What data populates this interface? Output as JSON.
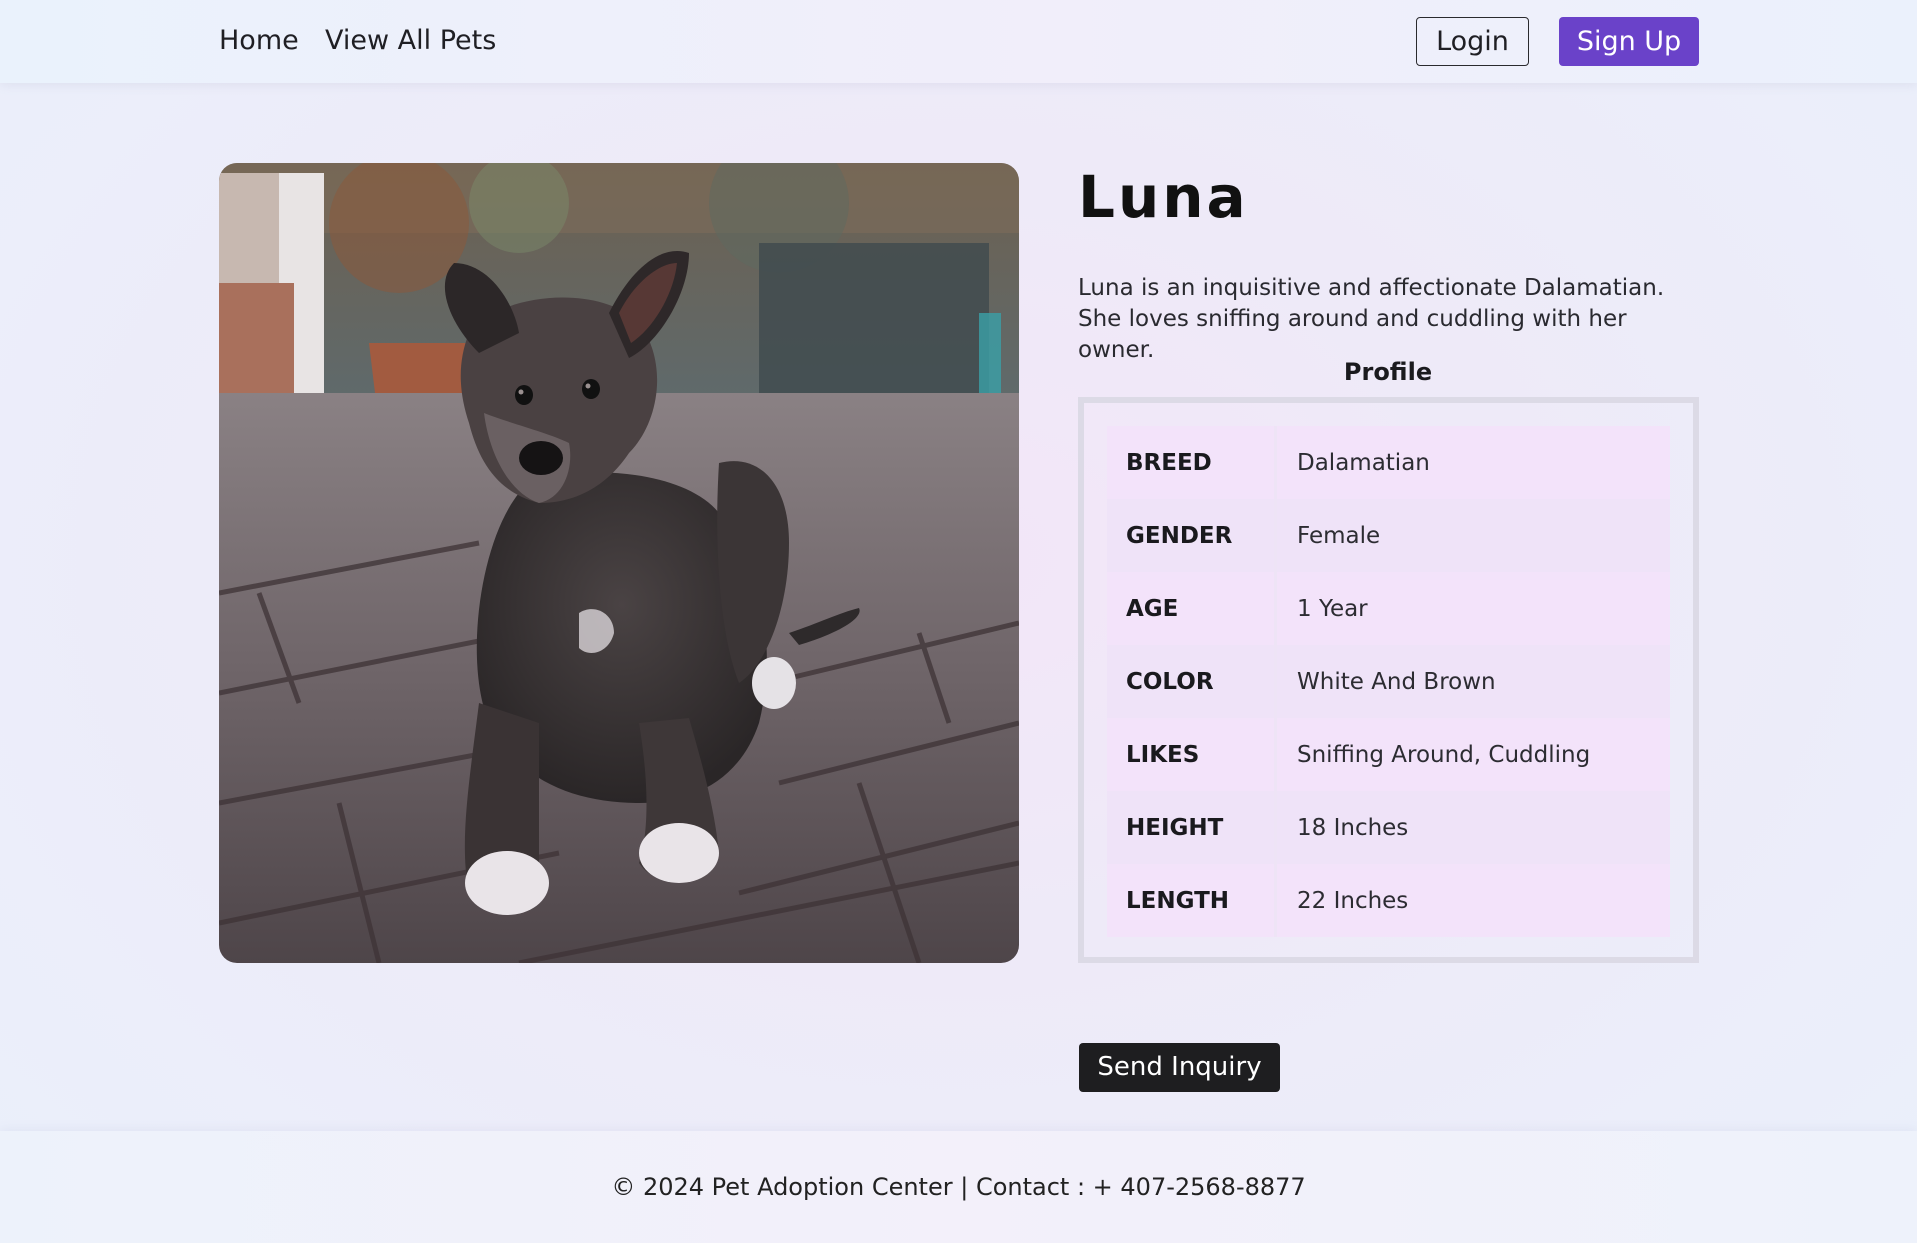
{
  "nav": {
    "home": "Home",
    "view_all_pets": "View All Pets",
    "login": "Login",
    "sign_up": "Sign Up"
  },
  "pet": {
    "name": "Luna",
    "description": "Luna is an inquisitive and affectionate Dalamatian. She loves sniffing around and cuddling with her owner.",
    "photo_icon": "dog-photo"
  },
  "profile": {
    "title": "Profile",
    "rows": [
      {
        "key": "BREED",
        "value": "Dalamatian"
      },
      {
        "key": "GENDER",
        "value": "Female"
      },
      {
        "key": "AGE",
        "value": "1 Year"
      },
      {
        "key": "COLOR",
        "value": "White And Brown"
      },
      {
        "key": "LIKES",
        "value": "Sniffing Around, Cuddling"
      },
      {
        "key": "HEIGHT",
        "value": "18 Inches"
      },
      {
        "key": "LENGTH",
        "value": "22 Inches"
      }
    ]
  },
  "actions": {
    "send_inquiry": "Send Inquiry"
  },
  "footer": {
    "text": "© 2024 Pet Adoption Center | Contact : + 407-2568-8877"
  },
  "colors": {
    "accent": "#6a42c9",
    "dark_button": "#1e1e20",
    "row_tint": "#f3e3fa"
  }
}
